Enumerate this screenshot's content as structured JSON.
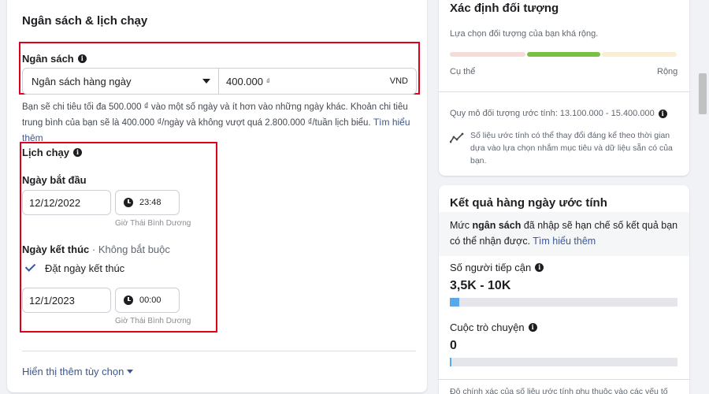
{
  "budget": {
    "section_title": "Ngân sách & lịch chạy",
    "label": "Ngân sách",
    "type_value": "Ngân sách hàng ngày",
    "amount_value": "400.000",
    "amount_symbol": "₫",
    "currency": "VND",
    "description": "Bạn sẽ chi tiêu tối đa 500.000 ₫ vào một số ngày và ít hơn vào những ngày khác. Khoản chi tiêu trung bình của bạn sẽ là 400.000 ₫/ngày và không vượt quá 2.800.000 ₫/tuần lịch biểu.",
    "learn_more": "Tìm hiểu thêm"
  },
  "schedule": {
    "label": "Lịch chạy",
    "start_label": "Ngày bắt đầu",
    "start_date": "12/12/2022",
    "start_time": "23:48",
    "start_timezone": "Giờ Thái Bình Dương",
    "end_label": "Ngày kết thúc",
    "end_optional": "· Không bắt buộc",
    "set_end_label": "Đặt ngày kết thúc",
    "end_date": "12/1/2023",
    "end_time": "00:00",
    "end_timezone": "Giờ Thái Bình Dương"
  },
  "more_options": "Hiển thị thêm tùy chọn",
  "audience": {
    "title": "Xác định đối tượng",
    "subtitle": "Lựa chọn đối tượng của bạn khá rộng.",
    "left_label": "Cụ thể",
    "right_label": "Rộng",
    "size_text": "Quy mô đối tượng ước tính: 13.100.000 - 15.400.000",
    "note": "Số liệu ước tính có thể thay đổi đáng kể theo thời gian dựa vào lựa chọn nhắm mục tiêu và dữ liệu sẵn có của bạn.",
    "level_colors": [
      "#f6dcd8",
      "#7ac143",
      "#f8efd2"
    ]
  },
  "results": {
    "title": "Kết quả hàng ngày ước tính",
    "note_prefix": "Mức ",
    "note_bold": "ngân sách",
    "note_suffix": " đã nhập sẽ hạn chế số kết quả bạn có thể nhận được.",
    "learn_more": "Tìm hiểu thêm",
    "reach_label": "Số người tiếp cận",
    "reach_value": "3,5K - 10K",
    "reach_fill": 0.04,
    "conv_label": "Cuộc trò chuyện",
    "conv_value": "0",
    "conv_fill": 0.005,
    "footer": "Độ chính xác của số liệu ước tính phụ thuộc vào các yếu tố"
  },
  "icons": {
    "info": "info-icon",
    "dropdown": "caret-down-icon",
    "clock": "clock-icon",
    "check": "checkmark-icon",
    "trend": "trend-line-icon"
  }
}
